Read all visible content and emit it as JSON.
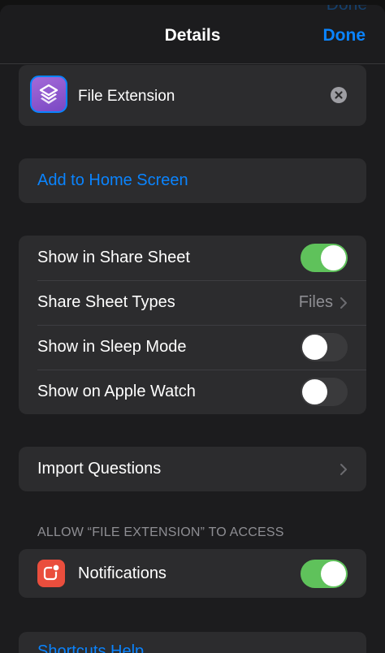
{
  "ghost_done": "Done",
  "nav": {
    "title": "Details",
    "done_label": "Done"
  },
  "shortcut": {
    "name": "File Extension",
    "icon": "shortcuts-layers-icon",
    "icon_color": "#9a5fd4"
  },
  "add_home": {
    "label": "Add to Home Screen"
  },
  "settings": {
    "share_sheet": {
      "label": "Show in Share Sheet",
      "on": true
    },
    "share_types": {
      "label": "Share Sheet Types",
      "value": "Files"
    },
    "sleep_mode": {
      "label": "Show in Sleep Mode",
      "on": false
    },
    "apple_watch": {
      "label": "Show on Apple Watch",
      "on": false
    }
  },
  "import_questions": {
    "label": "Import Questions"
  },
  "access": {
    "header": "ALLOW “FILE EXTENSION” TO ACCESS",
    "notifications": {
      "label": "Notifications",
      "on": true,
      "icon_color": "#ea4e3d"
    }
  },
  "help": {
    "label": "Shortcuts Help"
  },
  "colors": {
    "accent": "#0a84ff",
    "toggle_on": "#5fc25b",
    "card": "#2c2c2e",
    "sheet": "#1c1c1e"
  }
}
